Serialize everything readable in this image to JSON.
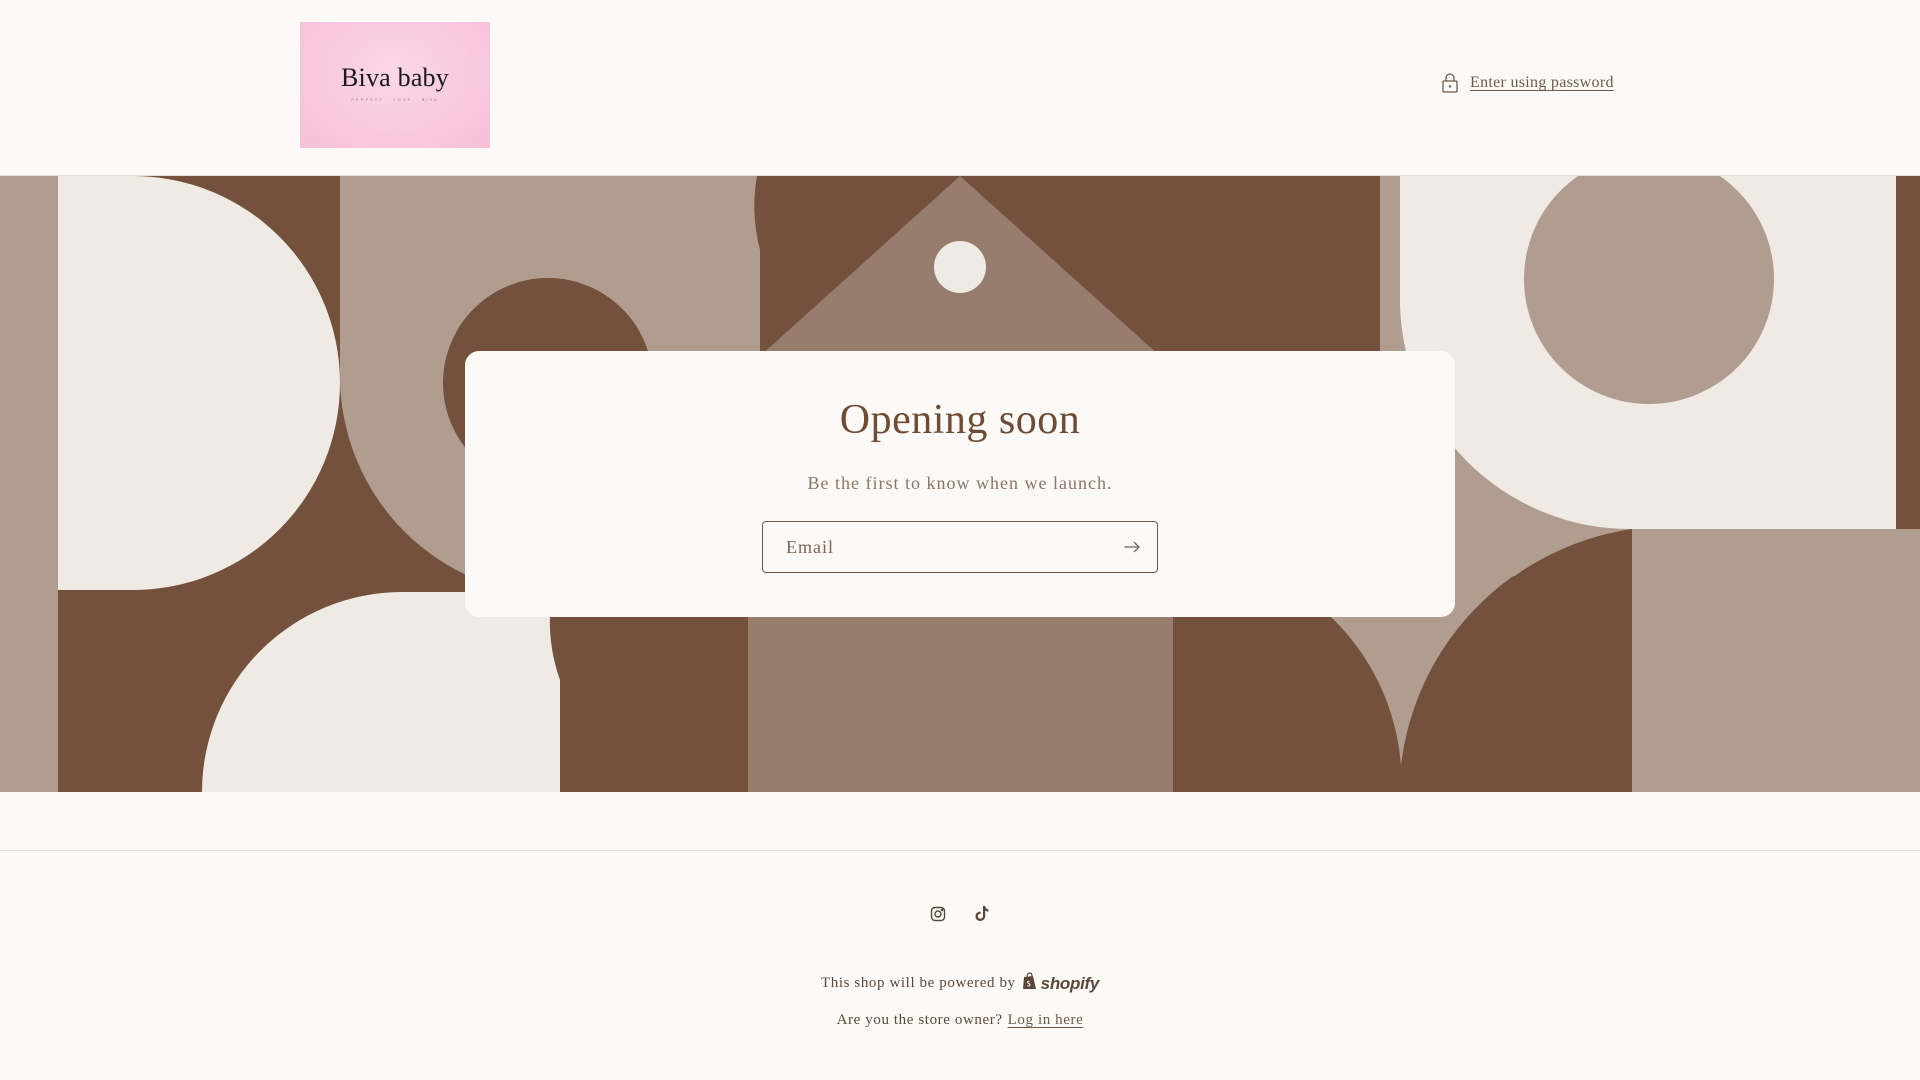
{
  "header": {
    "logo_title": "Biva baby",
    "logo_tagline": "PERFECT · LOVE · BIVA",
    "password_link": "Enter using password",
    "lock_icon": "lock-icon"
  },
  "banner": {
    "colors": {
      "dark_brown": "#73513c",
      "taupe": "#b09d8f",
      "mid_brown": "#977d6d",
      "cream": "#f0eae4"
    }
  },
  "card": {
    "title": "Opening soon",
    "subtitle": "Be the first to know when we launch.",
    "email_placeholder": "Email",
    "email_value": "",
    "submit_icon": "arrow-right-icon"
  },
  "footer": {
    "social": [
      {
        "name": "Instagram",
        "icon": "instagram-icon"
      },
      {
        "name": "TikTok",
        "icon": "tiktok-icon"
      }
    ],
    "powered_text": "This shop will be powered by",
    "powered_brand": "shopify",
    "owner_text": "Are you the store owner?",
    "login_link": "Log in here"
  },
  "colors": {
    "background": "#fcfaf6",
    "text": "#6f5a4a",
    "title": "#6f4c35"
  }
}
